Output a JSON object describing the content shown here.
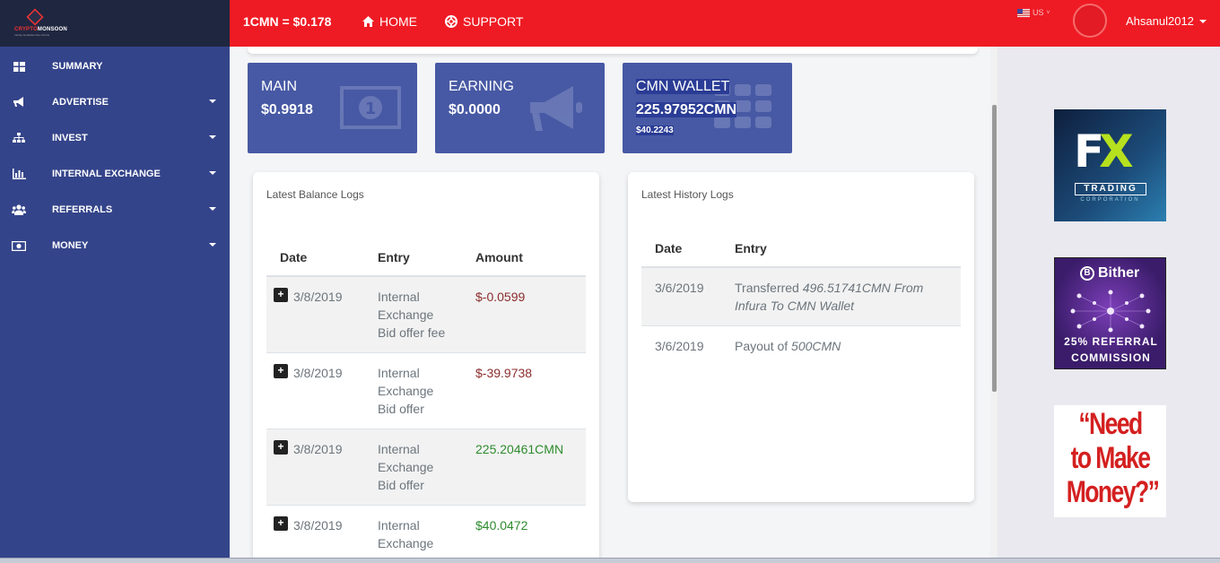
{
  "brand": {
    "logo_text_red": "CRYPTO",
    "logo_text_white": "MONSOON",
    "logo_tagline": "money & passive free returns",
    "accent": "#ef1b24",
    "sidebar_color": "#34448a"
  },
  "topbar": {
    "rate": "1CMN = $0.178",
    "home_label": "HOME",
    "support_label": "SUPPORT",
    "language": "US",
    "username": "Ahsanul2012"
  },
  "sidebar": {
    "items": [
      {
        "label": "SUMMARY",
        "icon": "dashboard-icon",
        "has_caret": false
      },
      {
        "label": "ADVERTISE",
        "icon": "megaphone-icon",
        "has_caret": true
      },
      {
        "label": "INVEST",
        "icon": "sitemap-icon",
        "has_caret": true
      },
      {
        "label": "INTERNAL EXCHANGE",
        "icon": "bar-chart-icon",
        "has_caret": true
      },
      {
        "label": "REFERRALS",
        "icon": "users-icon",
        "has_caret": true
      },
      {
        "label": "MONEY",
        "icon": "money-icon",
        "has_caret": true
      }
    ]
  },
  "stats": {
    "main": {
      "label": "MAIN",
      "value": "$0.9918",
      "icon": "banknote-icon"
    },
    "earning": {
      "label": "EARNING",
      "value": "$0.0000",
      "icon": "bullhorn-icon"
    },
    "wallet": {
      "label": "CMN WALLET",
      "value": "225.97952CMN",
      "sub": "$40.2243",
      "icon": "grid-icon"
    }
  },
  "balance_logs": {
    "title": "Latest Balance Logs",
    "headers": [
      "Date",
      "Entry",
      "Amount"
    ],
    "rows": [
      {
        "date": "3/8/2019",
        "entry": "Internal Exchange Bid offer fee",
        "amount": "$-0.0599"
      },
      {
        "date": "3/8/2019",
        "entry": "Internal Exchange Bid offer",
        "amount": "$-39.9738"
      },
      {
        "date": "3/8/2019",
        "entry": "Internal Exchange Bid offer",
        "amount": "225.20461CMN"
      },
      {
        "date": "3/8/2019",
        "entry": "Internal Exchange",
        "amount": "$40.0472"
      }
    ]
  },
  "history_logs": {
    "title": "Latest History Logs",
    "headers": [
      "Date",
      "Entry"
    ],
    "rows": [
      {
        "date": "3/6/2019",
        "entry_prefix": "Transferred ",
        "entry_italic": "496.51741CMN From Infura To CMN Wallet"
      },
      {
        "date": "3/6/2019",
        "entry_prefix": "Payout of ",
        "entry_italic": "500CMN"
      }
    ]
  },
  "ads": {
    "ad1": {
      "mark": "FX",
      "text": "TRADING",
      "sub": "CORPORATION"
    },
    "ad2": {
      "brand": "Bither",
      "line1": "25% REFERRAL",
      "line2": "COMMISSION"
    },
    "ad3": {
      "text": "“Need to Make Money?”"
    }
  }
}
